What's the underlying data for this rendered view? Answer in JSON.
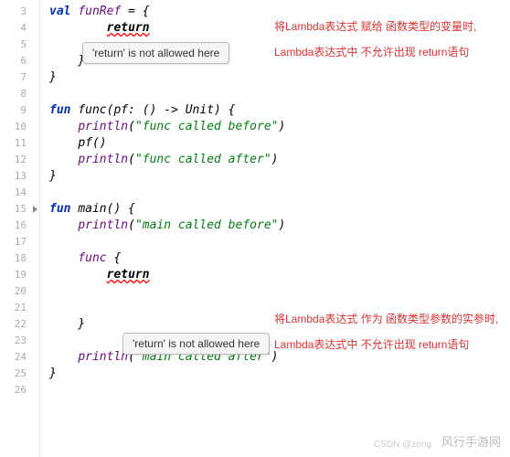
{
  "gutter": {
    "start": 3,
    "end": 26,
    "breakpoints": [
      15
    ]
  },
  "code": {
    "l3": {
      "kw": "val",
      "ident": "funRef",
      "eq": " = {"
    },
    "l4": {
      "ret": "return"
    },
    "l5": "",
    "l6": "    }",
    "l7": "}",
    "l8": "",
    "l9": {
      "kw": "fun",
      "fn": "func",
      "sig": "(pf: () -> Unit) {"
    },
    "l10": {
      "fn": "println",
      "str": "\"func called before\""
    },
    "l11": {
      "fn": "pf",
      "tail": "()"
    },
    "l12": {
      "fn": "println",
      "str": "\"func called after\""
    },
    "l13": "}",
    "l14": "",
    "l15": {
      "kw": "fun",
      "fn": "main",
      "sig": "() {"
    },
    "l16": {
      "fn": "println",
      "str": "\"main called before\""
    },
    "l17": "",
    "l18": {
      "fn": "func",
      "tail": " {"
    },
    "l19": {
      "ret": "return"
    },
    "l20": "",
    "l21": "",
    "l22": "    }",
    "l23": "",
    "l24": {
      "fn": "println",
      "str": "\"main called after\""
    },
    "l25": "}",
    "l26": ""
  },
  "tooltips": {
    "t1": "'return' is not allowed here",
    "t2": "'return' is not allowed here"
  },
  "comments": {
    "c1": "将Lambda表达式 赋给 函数类型的变量时,",
    "c2": "Lambda表达式中 不允许出现 return语句",
    "c3": "将Lambda表达式 作为 函数类型参数的实参时,",
    "c4": "Lambda表达式中 不允许出现 return语句"
  },
  "watermarks": {
    "w1": "风行手游网",
    "w2": "CSDN @zeng"
  }
}
